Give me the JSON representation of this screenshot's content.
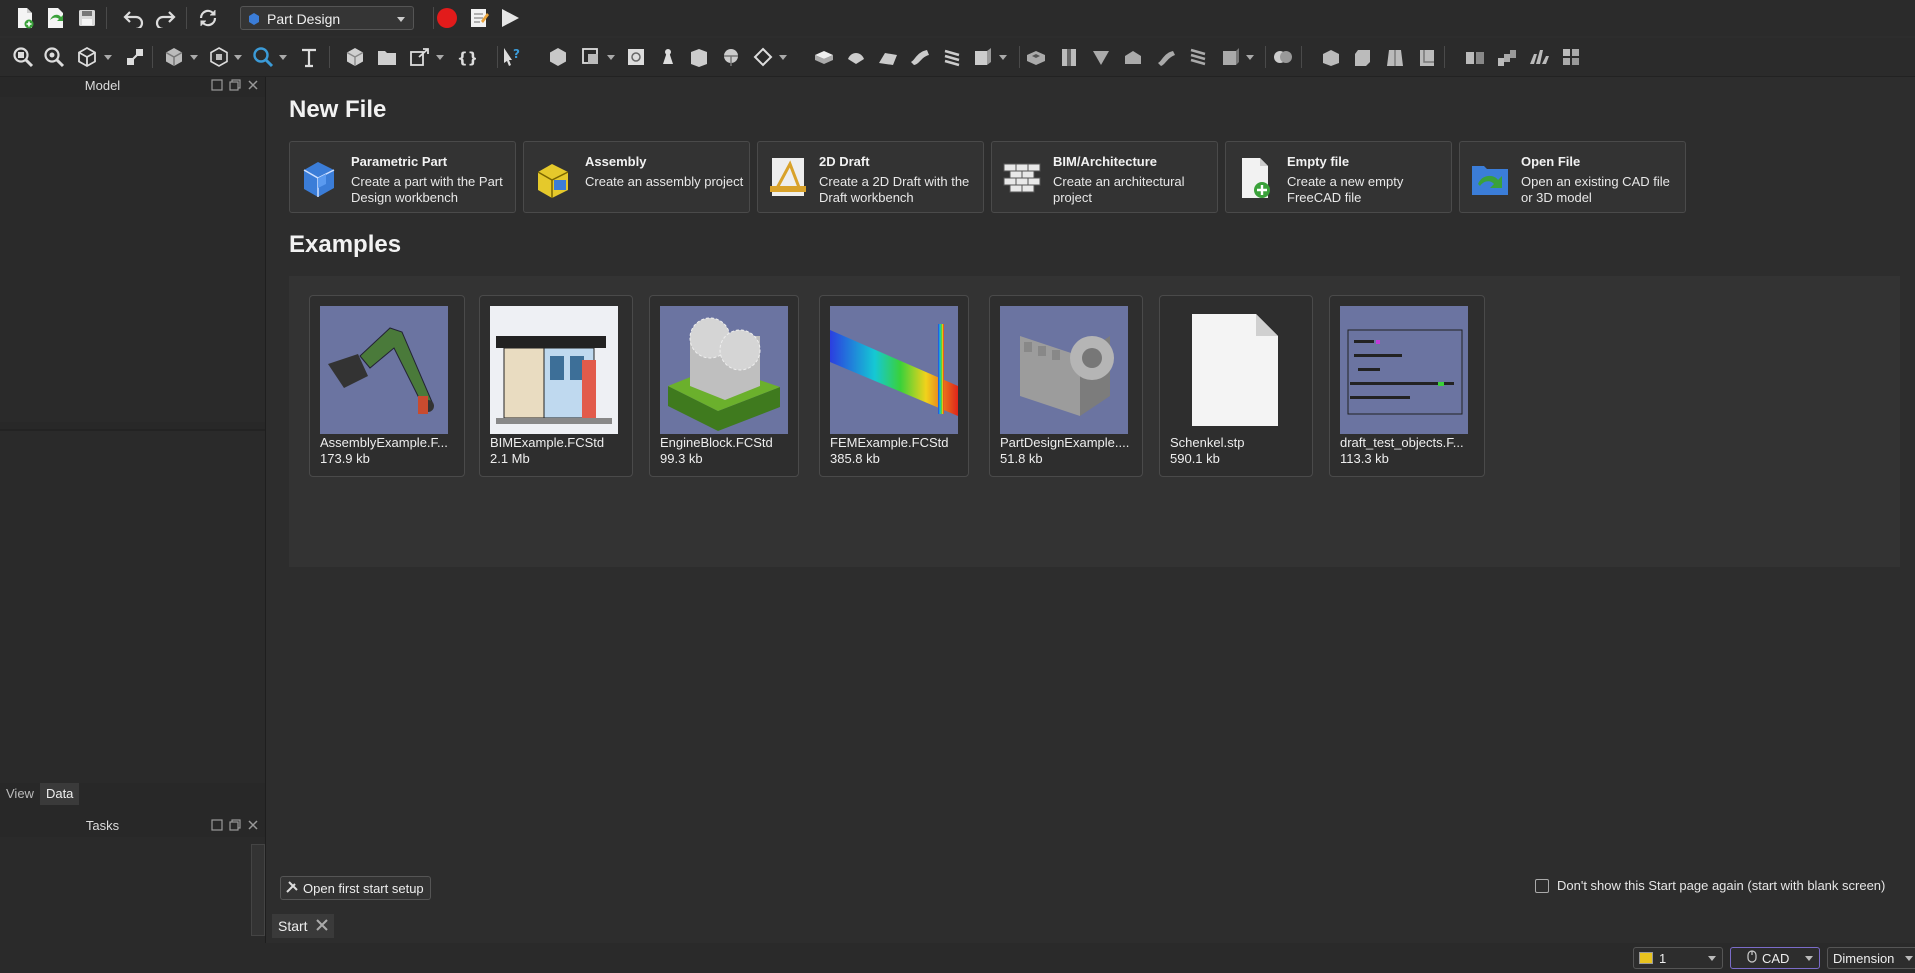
{
  "toolbar": {
    "workbench": "Part Design"
  },
  "left_panel": {
    "model_title": "Model",
    "tabs": [
      "View",
      "Data"
    ],
    "active_tab": "Data",
    "tasks_title": "Tasks"
  },
  "start_page": {
    "new_file_heading": "New File",
    "new_file_items": [
      {
        "title": "Parametric Part",
        "desc": "Create a part with the Part Design workbench",
        "icon": "part-design-icon"
      },
      {
        "title": "Assembly",
        "desc": "Create an assembly project",
        "icon": "assembly-icon"
      },
      {
        "title": "2D Draft",
        "desc": "Create a 2D Draft with the Draft workbench",
        "icon": "draft-icon"
      },
      {
        "title": "BIM/Architecture",
        "desc": "Create an architectural project",
        "icon": "bim-icon"
      },
      {
        "title": "Empty file",
        "desc": "Create a new empty FreeCAD file",
        "icon": "empty-file-icon"
      },
      {
        "title": "Open File",
        "desc": "Open an existing CAD file or 3D model",
        "icon": "open-file-icon"
      }
    ],
    "examples_heading": "Examples",
    "examples": [
      {
        "name": "AssemblyExample.F...",
        "size": "173.9 kb"
      },
      {
        "name": "BIMExample.FCStd",
        "size": "2.1 Mb"
      },
      {
        "name": "EngineBlock.FCStd",
        "size": "99.3 kb"
      },
      {
        "name": "FEMExample.FCStd",
        "size": "385.8 kb"
      },
      {
        "name": "PartDesignExample....",
        "size": "51.8 kb"
      },
      {
        "name": "Schenkel.stp",
        "size": "590.1 kb"
      },
      {
        "name": "draft_test_objects.F...",
        "size": "113.3 kb"
      }
    ],
    "first_start_button": "Open first start setup",
    "dont_show_label": "Don't show this Start page again (start with blank screen)"
  },
  "tabs": {
    "start": "Start"
  },
  "status_bar": {
    "layer": "1",
    "nav_style": "CAD",
    "dimension": "Dimension"
  }
}
